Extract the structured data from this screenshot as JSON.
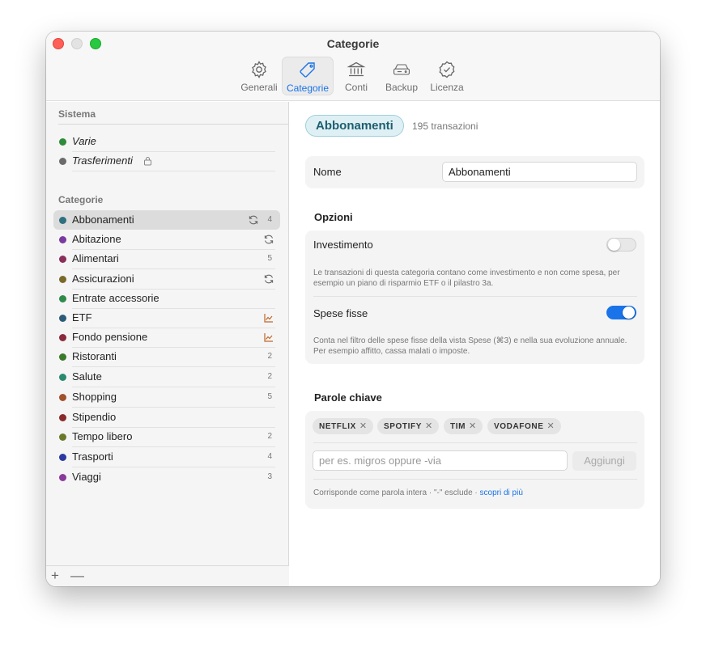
{
  "window": {
    "title": "Categorie"
  },
  "toolbar": {
    "items": [
      {
        "label": "Generali",
        "icon": "gear-icon"
      },
      {
        "label": "Categorie",
        "icon": "tag-icon",
        "active": true
      },
      {
        "label": "Conti",
        "icon": "bank-icon"
      },
      {
        "label": "Backup",
        "icon": "drive-icon"
      },
      {
        "label": "Licenza",
        "icon": "checkmark-seal-icon"
      }
    ]
  },
  "sidebar": {
    "system_header": "Sistema",
    "system_items": [
      {
        "label": "Varie",
        "color": "#2e8b3a"
      },
      {
        "label": "Trasferimenti",
        "color": "#6b6b6b",
        "locked": true
      }
    ],
    "categories_header": "Categorie",
    "categories": [
      {
        "label": "Abbonamenti",
        "color": "#2f6f80",
        "count": "4",
        "recurring": true
      },
      {
        "label": "Abitazione",
        "color": "#7a3aa0",
        "recurring": true
      },
      {
        "label": "Alimentari",
        "color": "#8a2f5a",
        "count": "5"
      },
      {
        "label": "Assicurazioni",
        "color": "#7a6a2a",
        "recurring": true
      },
      {
        "label": "Entrate accessorie",
        "color": "#2e8b4a"
      },
      {
        "label": "ETF",
        "color": "#2c5a7a",
        "investment": true
      },
      {
        "label": "Fondo pensione",
        "color": "#8a2a3a",
        "investment": true
      },
      {
        "label": "Ristoranti",
        "color": "#3a7a2a",
        "count": "2"
      },
      {
        "label": "Salute",
        "color": "#2a8a70",
        "count": "2"
      },
      {
        "label": "Shopping",
        "color": "#a0522d",
        "count": "5"
      },
      {
        "label": "Stipendio",
        "color": "#8a2a2a"
      },
      {
        "label": "Tempo libero",
        "color": "#6a7a2a",
        "count": "2"
      },
      {
        "label": "Trasporti",
        "color": "#2a3aa0",
        "count": "4"
      },
      {
        "label": "Viaggi",
        "color": "#8a3a9a",
        "count": "3"
      }
    ],
    "footer": {
      "add": "+",
      "remove": "—"
    }
  },
  "detail": {
    "name": "Abbonamenti",
    "transactions": "195 transazioni",
    "name_label": "Nome",
    "name_value": "Abbonamenti",
    "options_header": "Opzioni",
    "investment": {
      "label": "Investimento",
      "enabled": false,
      "description": "Le transazioni di questa categoria contano come investimento e non come spesa, per esempio un piano di risparmio ETF o il pilastro 3a."
    },
    "fixed": {
      "label": "Spese fisse",
      "enabled": true,
      "description": "Conta nel filtro delle spese fisse della vista Spese (⌘3) e nella sua evoluzione annuale. Per esempio affitto, cassa malati o imposte."
    },
    "keywords_header": "Parole chiave",
    "keywords": [
      "NETFLIX",
      "SPOTIFY",
      "TIM",
      "VODAFONE"
    ],
    "keyword_placeholder": "per es. migros oppure -via",
    "add_button": "Aggiungi",
    "hint_text": "Corrisponde come parola intera · \"-\" esclude · ",
    "hint_link": "scopri di più"
  },
  "colors": {
    "accent": "#1a73e8",
    "selected_row": "#dcdcdc"
  }
}
